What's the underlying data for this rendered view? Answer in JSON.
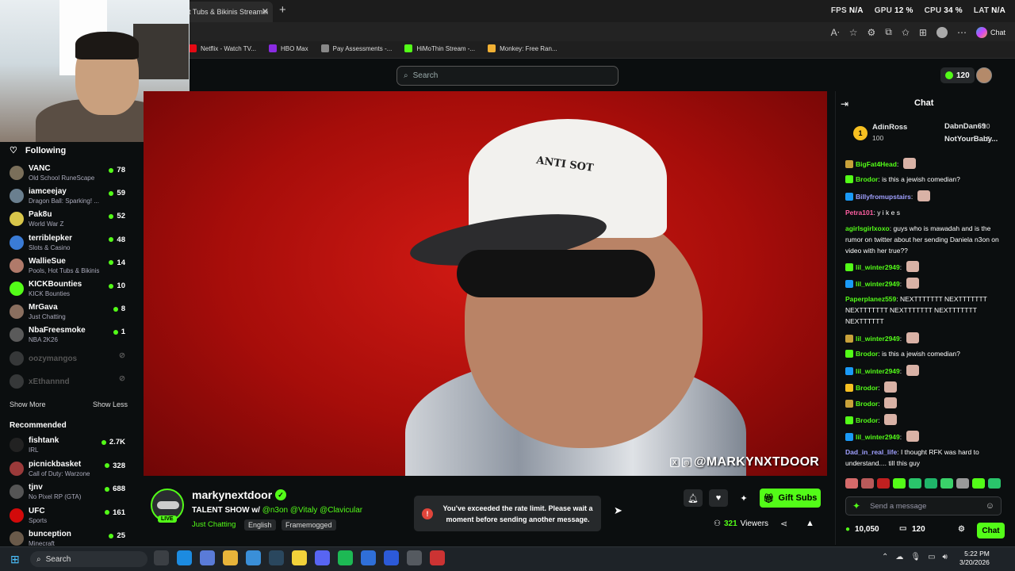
{
  "browser": {
    "tab_title": "t Tubs & Bikinis Streamin",
    "perf": [
      {
        "label": "FPS",
        "value": "N/A"
      },
      {
        "label": "GPU",
        "value": "12 %"
      },
      {
        "label": "CPU",
        "value": "34 %"
      },
      {
        "label": "LAT",
        "value": "N/A"
      }
    ],
    "chat_button_label": "Chat",
    "bookmarks": [
      {
        "label": "Netflix - Watch TV...",
        "color": "#e50914"
      },
      {
        "label": "HBO Max",
        "color": "#8a2be2"
      },
      {
        "label": "Pay Assessments -...",
        "color": "#888888"
      },
      {
        "label": "HiMoThin Stream -...",
        "color": "#53fc18"
      },
      {
        "label": "Monkey: Free Ran...",
        "color": "#f2b134"
      }
    ]
  },
  "topbar": {
    "search_placeholder": "Search",
    "points": "120"
  },
  "sidebar": {
    "following_label": "Following",
    "following": [
      {
        "name": "VANC",
        "game": "Old School RuneScape",
        "viewers": "78",
        "color": "#7a6f5a"
      },
      {
        "name": "iamceejay",
        "game": "Dragon Ball: Sparking! ...",
        "viewers": "59",
        "color": "#6a7f8f"
      },
      {
        "name": "Pak8u",
        "game": "World War Z",
        "viewers": "52",
        "color": "#d8c64a"
      },
      {
        "name": "terriblepker",
        "game": "Slots & Casino",
        "viewers": "48",
        "color": "#3a7bd5"
      },
      {
        "name": "WallieSue",
        "game": "Pools, Hot Tubs & Bikinis",
        "viewers": "14",
        "color": "#b07a6a"
      },
      {
        "name": "KICKBounties",
        "game": "KICK Bounties",
        "viewers": "10",
        "color": "#53fc18"
      },
      {
        "name": "MrGava",
        "game": "Just Chatting",
        "viewers": "8",
        "color": "#8a6f5f"
      },
      {
        "name": "NbaFreesmoke",
        "game": "NBA 2K26",
        "viewers": "1",
        "color": "#5a5a5a"
      },
      {
        "name": "oozymangos",
        "offline": true,
        "color": "#777777"
      },
      {
        "name": "xEthannnd",
        "offline": true,
        "color": "#777777"
      }
    ],
    "show_more": "Show More",
    "show_less": "Show Less",
    "recommended_label": "Recommended",
    "recommended": [
      {
        "name": "fishtank",
        "game": "IRL",
        "viewers": "2.7K",
        "color": "#222222"
      },
      {
        "name": "picnickbasket",
        "game": "Call of Duty: Warzone",
        "viewers": "328",
        "color": "#9a3a3a"
      },
      {
        "name": "tjnv",
        "game": "No Pixel RP (GTA)",
        "viewers": "688",
        "color": "#555555"
      },
      {
        "name": "UFC",
        "game": "Sports",
        "viewers": "161",
        "color": "#d20a0a"
      },
      {
        "name": "bunception",
        "game": "Minecraft",
        "viewers": "25",
        "color": "#6a5a4a"
      }
    ]
  },
  "video": {
    "cap_text": "ANTI SOT",
    "watermark": "@MARKYNXTDOOR"
  },
  "stream": {
    "streamer": "markynextdoor",
    "live": "LIVE",
    "title": "TALENT SHOW w/",
    "mentions": "@n3on @Vitaly @Clavicular",
    "category": "Just Chatting",
    "tags": [
      "English",
      "Framemogged"
    ],
    "gift_label": "Gift Subs",
    "viewers_count": "321",
    "viewers_label": "Viewers",
    "toast": "You've exceeded the rate limit. Please wait a moment before sending another message."
  },
  "chat": {
    "title": "Chat",
    "leaderboard": [
      {
        "name": "AdinRoss",
        "value": "100",
        "color": "#f7c021"
      },
      {
        "name": "DabnDan69",
        "value": "10",
        "color": "#ffffff"
      },
      {
        "name": "NotYourBaby...",
        "value": "5",
        "color": "#f7c021"
      }
    ],
    "messages": [
      {
        "user": "BigFat4Head",
        "text": "",
        "color": "#53fc18",
        "emote": true
      },
      {
        "user": "Brodor",
        "text": "is this a jewish comedian?",
        "color": "#53fc18",
        "emote": false
      },
      {
        "user": "Billyfromupstairs",
        "text": "",
        "color": "#a0a0ff",
        "emote": true
      },
      {
        "user": "Petra101",
        "text": "y i k e s",
        "color": "#ff5fa2",
        "emote": false
      },
      {
        "user": "agirlsgirlxoxo",
        "text": "guys who is mawadah and is the rumor on twitter about her sending Daniela n3on on video with her true??",
        "color": "#53fc18",
        "emote": false
      },
      {
        "user": "lil_winter2949",
        "text": "",
        "color": "#53fc18",
        "emote": true
      },
      {
        "user": "lil_winter2949",
        "text": "",
        "color": "#53fc18",
        "emote": true
      },
      {
        "user": "Paperplanez559",
        "text": "NEXTTTTTTT NEXTTTTTTT NEXTTTTTTT NEXTTTTTTT NEXTTTTTTT NEXTTTTTT",
        "color": "#53fc18",
        "emote": false
      },
      {
        "user": "lil_winter2949",
        "text": "",
        "color": "#53fc18",
        "emote": true
      },
      {
        "user": "Brodor",
        "text": "is this a jewish comedian?",
        "color": "#53fc18",
        "emote": false
      },
      {
        "user": "lil_winter2949",
        "text": "",
        "color": "#53fc18",
        "emote": true
      },
      {
        "user": "Brodor",
        "text": "",
        "color": "#53fc18",
        "emote": true
      },
      {
        "user": "Brodor",
        "text": "",
        "color": "#53fc18",
        "emote": true
      },
      {
        "user": "Brodor",
        "text": "",
        "color": "#53fc18",
        "emote": true
      },
      {
        "user": "lil_winter2949",
        "text": "",
        "color": "#53fc18",
        "emote": true
      },
      {
        "user": "Dad_in_real_life",
        "text": "I thought RFK was hard to understand.... till this guy",
        "color": "#a0a0ff",
        "emote": false
      }
    ],
    "input_placeholder": "Send a message",
    "balance": "10,050",
    "sub_count": "120",
    "send_label": "Chat"
  },
  "taskbar": {
    "search_label": "Search",
    "time": "5:22 PM",
    "date": "3/20/2026"
  }
}
